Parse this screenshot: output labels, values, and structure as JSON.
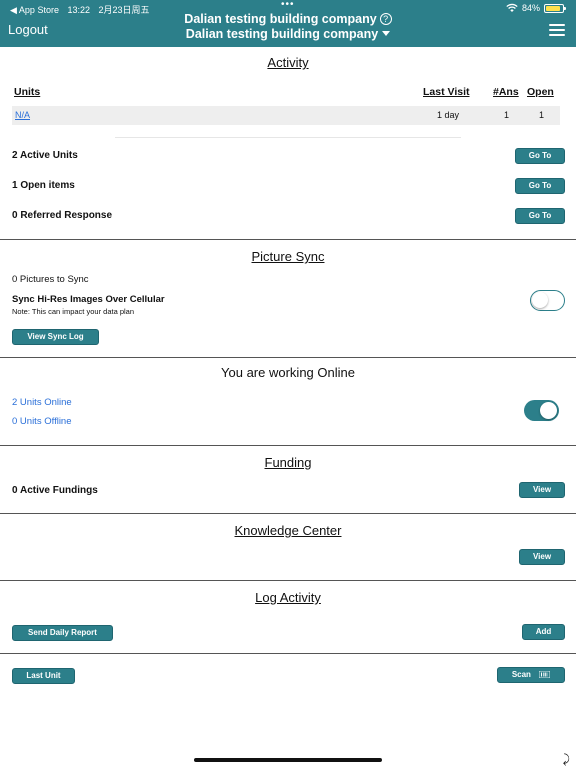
{
  "status_bar": {
    "back_app": "◀ App Store",
    "time": "13:22",
    "date": "2月23日周五",
    "battery": "84%"
  },
  "header": {
    "logout": "Logout",
    "company_title": "Dalian testing building company",
    "company_selector": "Dalian testing building company",
    "help": "?"
  },
  "activity": {
    "title": "Activity",
    "columns": [
      "Units",
      "Last Visit",
      "#Ans",
      "Open"
    ],
    "rows": [
      {
        "unit": "N/A",
        "last_visit": "1 day",
        "ans": "1",
        "open": "1"
      }
    ],
    "items": [
      {
        "label": "2 Active Units",
        "button": "Go To"
      },
      {
        "label": "1 Open items",
        "button": "Go To"
      },
      {
        "label": "0 Referred Response",
        "button": "Go To"
      }
    ]
  },
  "picture_sync": {
    "title": "Picture Sync",
    "pictures_to_sync": "0 Pictures to Sync",
    "hires_label": "Sync Hi-Res Images Over Cellular",
    "note": "Note: This can impact your data plan",
    "view_log_button": "View Sync Log",
    "hires_enabled": false
  },
  "online": {
    "title": "You are working Online",
    "units_online": "2 Units Online",
    "units_offline": "0 Units Offline",
    "online_enabled": true
  },
  "funding": {
    "title": "Funding",
    "active_fundings": "0 Active Fundings",
    "view_button": "View"
  },
  "knowledge": {
    "title": "Knowledge Center",
    "view_button": "View"
  },
  "log_activity": {
    "title": "Log Activity",
    "send_report_button": "Send Daily Report",
    "add_button": "Add"
  },
  "footer": {
    "last_unit_button": "Last Unit",
    "scan_button": "Scan"
  },
  "colors": {
    "accent": "#2c7f8a",
    "link": "#2a6fd8"
  }
}
